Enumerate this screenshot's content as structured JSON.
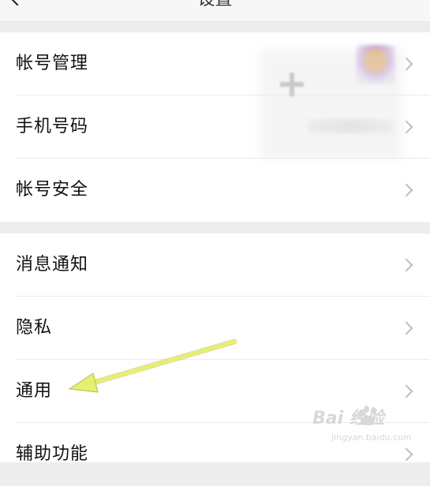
{
  "header": {
    "title": "设置"
  },
  "groups": [
    {
      "items": [
        {
          "label": "帐号管理"
        },
        {
          "label": "手机号码"
        },
        {
          "label": "帐号安全"
        }
      ]
    },
    {
      "items": [
        {
          "label": "消息通知"
        },
        {
          "label": "隐私"
        },
        {
          "label": "通用"
        },
        {
          "label": "辅助功能"
        }
      ]
    }
  ],
  "watermark": {
    "brand": "Bai 经验",
    "url": "jingyan.baidu.com"
  },
  "colors": {
    "background": "#ededed",
    "card": "#ffffff",
    "arrow": "#e6ef6f",
    "chevron": "#bdbdbd"
  }
}
